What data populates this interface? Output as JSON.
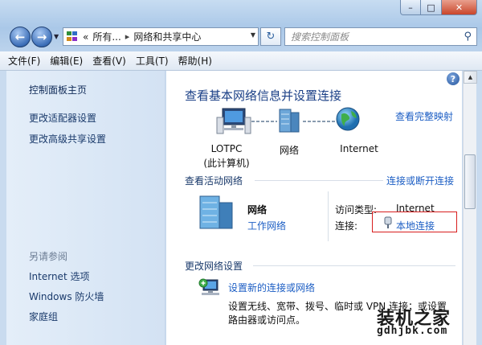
{
  "window": {
    "controls": {
      "minimize": "–",
      "maximize": "□",
      "close": "✕"
    }
  },
  "address_bar": {
    "crumbs": [
      "«",
      "所有...",
      "网络和共享中心"
    ],
    "search_placeholder": "搜索控制面板"
  },
  "menu": {
    "items": [
      "文件(F)",
      "编辑(E)",
      "查看(V)",
      "工具(T)",
      "帮助(H)"
    ]
  },
  "sidebar": {
    "items": [
      "控制面板主页",
      "更改适配器设置",
      "更改高级共享设置"
    ],
    "see_also_title": "另请参阅",
    "see_also": [
      "Internet 选项",
      "Windows 防火墙",
      "家庭组"
    ]
  },
  "main": {
    "help": "?",
    "title": "查看基本网络信息并设置连接",
    "view_full_map": "查看完整映射",
    "map": {
      "nodes": [
        {
          "label": "LOTPC",
          "sub": "(此计算机)"
        },
        {
          "label": "网络"
        },
        {
          "label": "Internet"
        }
      ]
    },
    "active_networks": {
      "heading": "查看活动网络",
      "connect_link": "连接或断开连接",
      "network_name": "网络",
      "network_type": "工作网络",
      "access_type_label": "访问类型:",
      "access_type_value": "Internet",
      "connection_label": "连接:",
      "connection_value": "本地连接"
    },
    "change_settings": {
      "heading": "更改网络设置",
      "setup_link": "设置新的连接或网络",
      "setup_desc_1": "设置无线、宽带、拨号、临时或 VPN 连接；或设置",
      "setup_desc_2": "路由器或访问点。"
    }
  },
  "watermark": {
    "text": "装机之家",
    "url": "gdhjbk.com"
  }
}
